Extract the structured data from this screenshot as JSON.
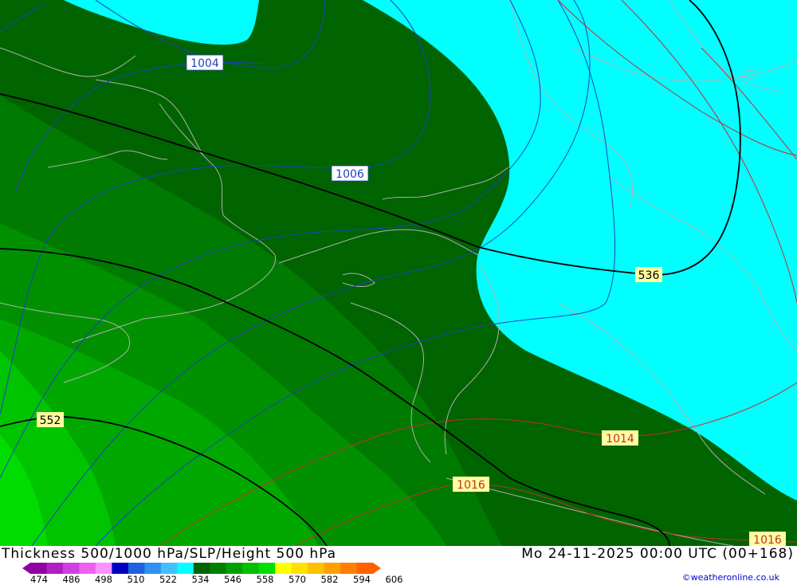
{
  "map": {
    "thickness_labels": [
      "536",
      "552"
    ],
    "slp_labels": [
      "1004",
      "1006",
      "1014",
      "1016",
      "1016"
    ],
    "colors": {
      "cyan": "#00ffff",
      "dark_green": "#006400",
      "green2": "#007a00",
      "green3": "#009000",
      "green4": "#00a800",
      "green5": "#00c400",
      "green6": "#00dc00",
      "slp_blue": "#2040c0",
      "slp_red": "#c03030",
      "geopotential": "#000000",
      "coast": "#b0b0b0"
    }
  },
  "footer": {
    "title": "Thickness 500/1000 hPa/SLP/Height 500 hPa",
    "datetime": "Mo 24-11-2025 00:00 UTC (00+168)",
    "credit": "©weatheronline.co.uk",
    "legend_ticks": [
      "474",
      "486",
      "498",
      "510",
      "522",
      "534",
      "546",
      "558",
      "570",
      "582",
      "594",
      "606"
    ],
    "legend_colors": [
      "#9000a0",
      "#b020c0",
      "#d040e0",
      "#f060f0",
      "#ff90ff",
      "#0000c0",
      "#2060e0",
      "#3090f0",
      "#40c0ff",
      "#00ffff",
      "#006400",
      "#008000",
      "#00a000",
      "#00c000",
      "#00e000",
      "#ffff00",
      "#ffe000",
      "#ffc000",
      "#ffa000",
      "#ff8000",
      "#ff6000"
    ]
  }
}
